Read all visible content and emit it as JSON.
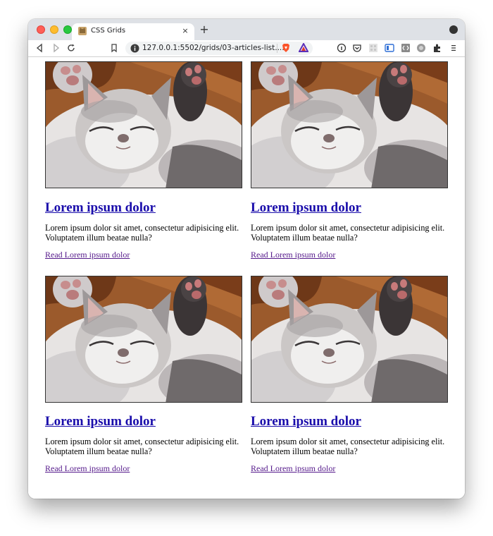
{
  "browser": {
    "tab_title": "CSS Grids",
    "tab_close_glyph": "×",
    "new_tab_glyph": "+",
    "url": "127.0.0.1:5502/grids/03-articles-list....",
    "colors": {
      "tabbar": "#dee1e6",
      "link": "#1a0dab",
      "visited": "#551a8b"
    }
  },
  "articles": [
    {
      "title": "Lorem ipsum dolor",
      "text": "Lorem ipsum dolor sit amet, consectetur adipisicing elit. Voluptatem illum beatae nulla?",
      "link": "Read Lorem ipsum dolor"
    },
    {
      "title": "Lorem ipsum dolor",
      "text": "Lorem ipsum dolor sit amet, consectetur adipisicing elit. Voluptatem illum beatae nulla?",
      "link": "Read Lorem ipsum dolor"
    },
    {
      "title": "Lorem ipsum dolor",
      "text": "Lorem ipsum dolor sit amet, consectetur adipisicing elit. Voluptatem illum beatae nulla?",
      "link": "Read Lorem ipsum dolor"
    },
    {
      "title": "Lorem ipsum dolor",
      "text": "Lorem ipsum dolor sit amet, consectetur adipisicing elit. Voluptatem illum beatae nulla?",
      "link": "Read Lorem ipsum dolor"
    }
  ]
}
